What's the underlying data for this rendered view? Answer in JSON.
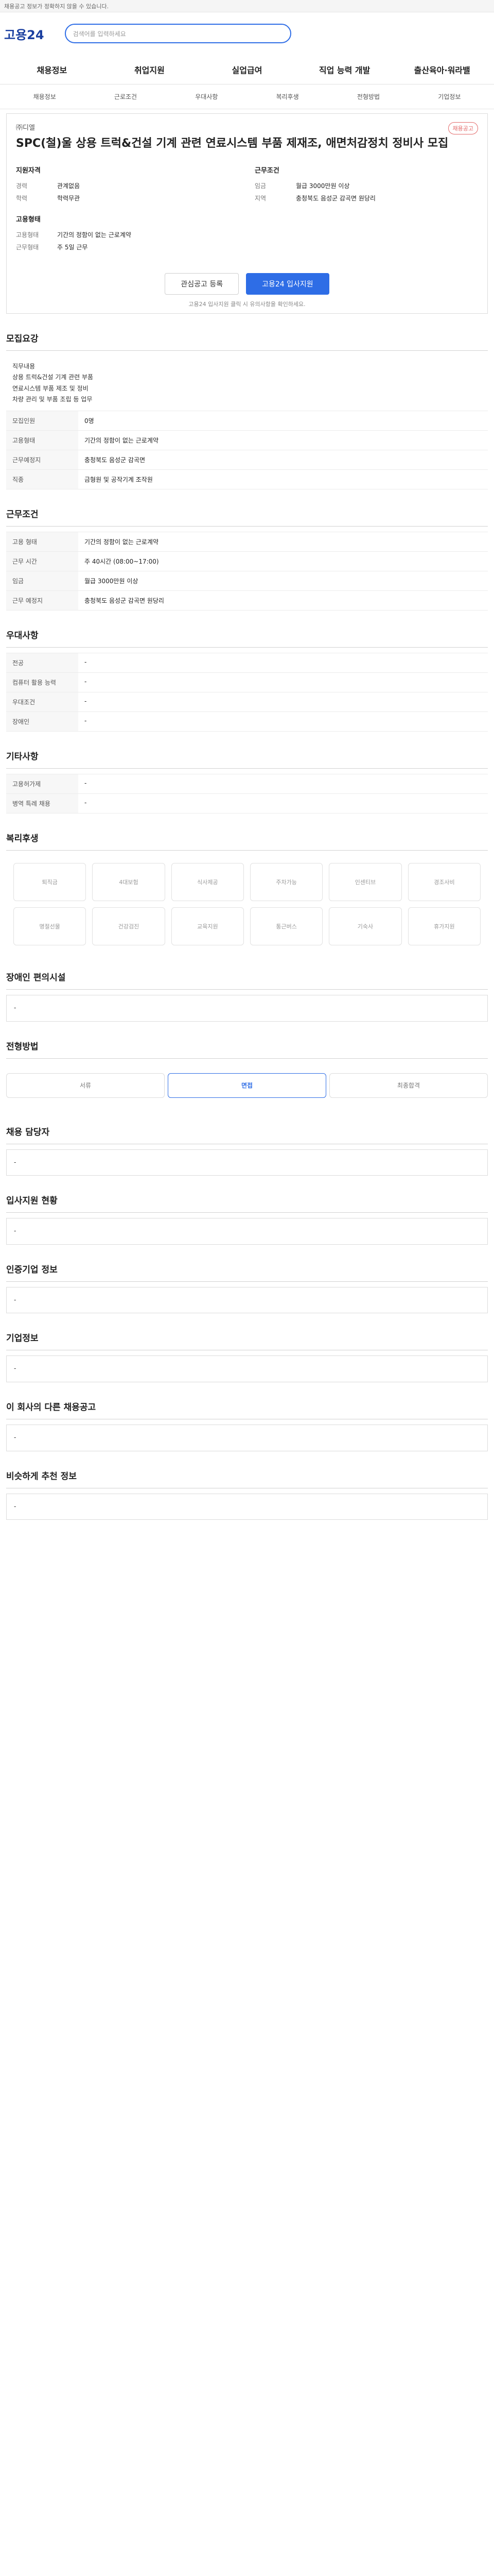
{
  "topbar": {
    "text": "채용공고 정보가 정확하지 않을 수 있습니다."
  },
  "header": {
    "logo": "고용24",
    "search_placeholder": "검색어를 입력하세요"
  },
  "nav": {
    "items": [
      "채용정보",
      "취업지원",
      "실업급여",
      "직업 능력 개발",
      "출산육아·워라밸"
    ]
  },
  "tabs": {
    "items": [
      "채용정보",
      "근로조건",
      "우대사항",
      "복리후생",
      "전형방법",
      "기업정보"
    ]
  },
  "job": {
    "badge": "채용공고",
    "company": "㈜디엘",
    "title": "SPC(철)울 상용 트럭&건설 기계 관련 연료시스템 부품 제재조, 애면처감정치 정비사 모집",
    "summary": {
      "left_head": "지원자격",
      "left": [
        {
          "k": "경력",
          "v": "관계없음"
        },
        {
          "k": "학력",
          "v": "학력무관"
        }
      ],
      "right_head": "근무조건",
      "right": [
        {
          "k": "임금",
          "v": "월급 3000만원 이상"
        },
        {
          "k": "지역",
          "v": "충청북도 음성군 감곡면 원당리"
        }
      ],
      "extra_left_head": "고용형태",
      "extra_left": [
        {
          "k": "고용형태",
          "v": "기간의 정함이 없는 근로계약"
        },
        {
          "k": "근무형태",
          "v": "주 5일 근무"
        }
      ]
    },
    "buttons": {
      "save": "관심공고 등록",
      "apply": "고용24 입사지원"
    },
    "note": "고용24 입사지원 클릭 시 유의사항을 확인하세요."
  },
  "sections": {
    "recruit_title": "모집요강",
    "recruit_desc_lines": [
      "직무내용",
      "상용 트럭&건설 기계 관련 부품",
      "연료시스템 부품 제조 및 정비",
      "차량 관리 및 부품 조립 등 업무"
    ],
    "recruit_rows": [
      {
        "label": "모집인원",
        "value": "0명"
      },
      {
        "label": "고용형태",
        "value": "기간의 정함이 없는 근로계약"
      },
      {
        "label": "근무예정지",
        "value": "충청북도 음성군 감곡면"
      },
      {
        "label": "직종",
        "value": "금형원 및 공작기계 조작원"
      }
    ],
    "condition_title": "근무조건",
    "condition_rows": [
      {
        "label": "고용 형태",
        "value": "기간의 정함이 없는 근로계약"
      },
      {
        "label": "근무 시간",
        "value": "주 40시간 (08:00~17:00)"
      },
      {
        "label": "임금",
        "value": "월급 3000만원 이상"
      },
      {
        "label": "근무 예정지",
        "value": "충청북도 음성군 감곡면 원당리"
      }
    ],
    "preference_title": "우대사항",
    "preference_rows": [
      {
        "label": "전공",
        "value": "-"
      },
      {
        "label": "컴퓨터 활용 능력",
        "value": "-"
      },
      {
        "label": "우대조건",
        "value": "-"
      },
      {
        "label": "장애인",
        "value": "-"
      }
    ],
    "other_title": "기타사항",
    "other_rows": [
      {
        "label": "고용허가제",
        "value": "-"
      },
      {
        "label": "병역 특례 채용",
        "value": "-"
      }
    ],
    "welfare_title": "복리후생",
    "welfare_items": [
      "퇴직금",
      "4대보험",
      "식사제공",
      "주차가능",
      "인센티브",
      "경조사비",
      "명절선물",
      "건강검진",
      "교육지원",
      "통근버스",
      "기숙사",
      "휴가지원"
    ],
    "disabled_title": "장애인 편의시설",
    "process_title": "전형방법",
    "process_steps": [
      "서류",
      "면접",
      "최종합격"
    ],
    "contact_title": "채용 담당자",
    "apply_title": "입사지원 현황",
    "info_title": "인증기업 정보",
    "company_title": "기업정보",
    "similar_title": "이 회사의 다른 채용공고",
    "recommend_title": "비슷하게 추천 정보"
  }
}
